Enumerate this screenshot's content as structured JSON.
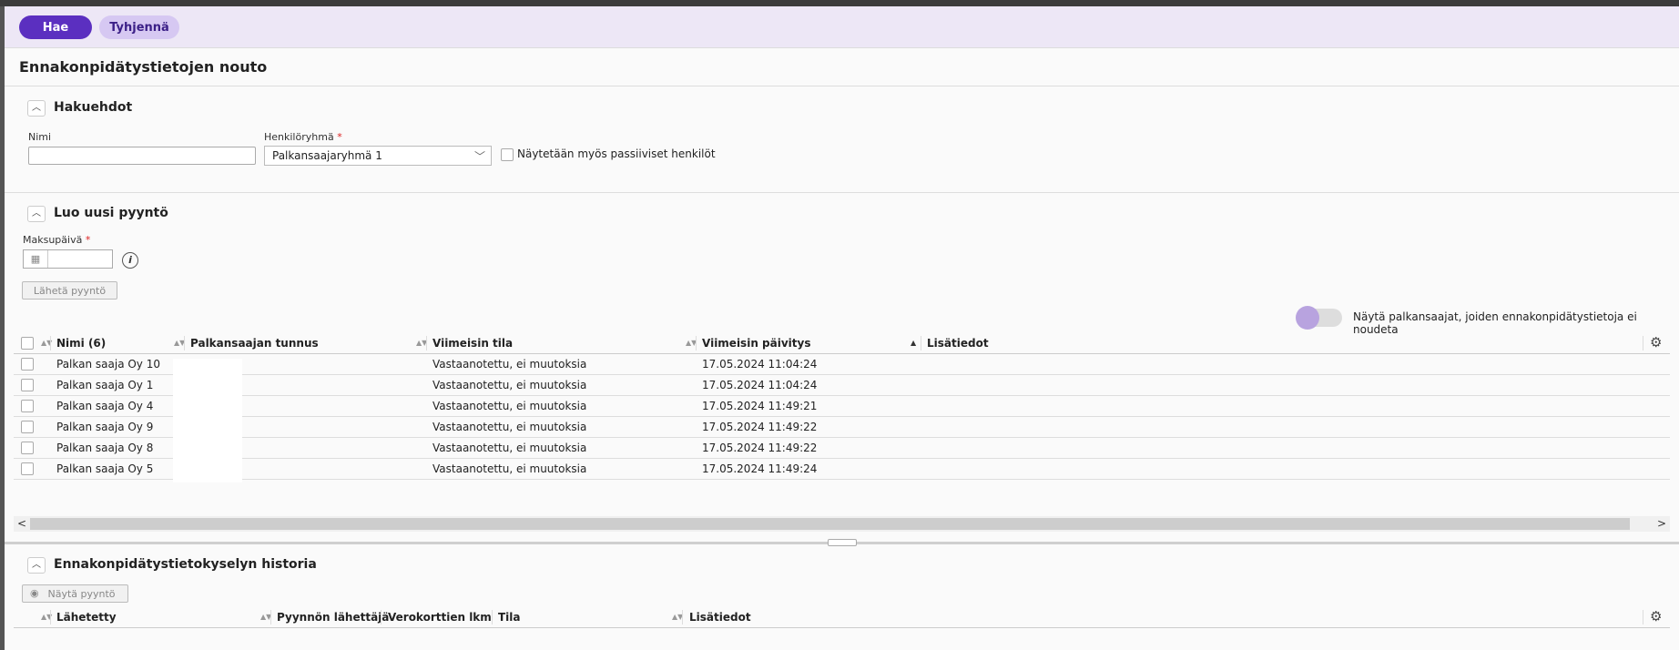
{
  "toolbar": {
    "search_label": "Hae",
    "clear_label": "Tyhjennä"
  },
  "page": {
    "title": "Ennakonpidätystietojen nouto"
  },
  "search_section": {
    "title": "Hakuehdot",
    "name_label": "Nimi",
    "name_value": "",
    "group_label": "Henkilöryhmä",
    "group_required_mark": "*",
    "group_value": "Palkansaajaryhmä 1",
    "passive_checkbox_label": "Näytetään myös passiiviset henkilöt",
    "passive_checked": false
  },
  "new_request_section": {
    "title": "Luo uusi pyyntö",
    "payday_label": "Maksupäivä",
    "payday_required_mark": "*",
    "payday_value": "",
    "send_button_label": "Lähetä pyyntö"
  },
  "filter_toggle": {
    "label": "Näytä palkansaajat, joiden ennakonpidätystietoja ei noudeta",
    "on": false
  },
  "payees_table": {
    "columns": [
      "Nimi (6)",
      "Palkansaajan tunnus",
      "Viimeisin tila",
      "Viimeisin päivitys",
      "Lisätiedot"
    ],
    "rows": [
      {
        "name": "Palkan saaja Oy 10",
        "id": "",
        "status": "Vastaanotettu, ei muutoksia",
        "updated": "17.05.2024 11:04:24",
        "info": ""
      },
      {
        "name": "Palkan saaja Oy 1",
        "id": "",
        "status": "Vastaanotettu, ei muutoksia",
        "updated": "17.05.2024 11:04:24",
        "info": ""
      },
      {
        "name": "Palkan saaja Oy 4",
        "id": "",
        "status": "Vastaanotettu, ei muutoksia",
        "updated": "17.05.2024 11:49:21",
        "info": ""
      },
      {
        "name": "Palkan saaja Oy 9",
        "id": "",
        "status": "Vastaanotettu, ei muutoksia",
        "updated": "17.05.2024 11:49:22",
        "info": ""
      },
      {
        "name": "Palkan saaja Oy 8",
        "id": "",
        "status": "Vastaanotettu, ei muutoksia",
        "updated": "17.05.2024 11:49:22",
        "info": ""
      },
      {
        "name": "Palkan saaja Oy 5",
        "id": "",
        "status": "Vastaanotettu, ei muutoksia",
        "updated": "17.05.2024 11:49:24",
        "info": ""
      }
    ]
  },
  "history_section": {
    "title": "Ennakonpidätystietokyselyn historia",
    "show_request_label": "Näytä pyyntö",
    "columns": [
      "Lähetetty",
      "Pyynnön lähettäjä",
      "Verokorttien lkm",
      "Tila",
      "Lisätiedot"
    ]
  },
  "icons": {
    "collapse": "chevron-up-icon",
    "calendar": "calendar-icon",
    "info": "info-icon",
    "settings": "gear-icon",
    "eye": "eye-icon"
  },
  "colors": {
    "primary": "#5b2fc0",
    "secondary": "#d6c8f2",
    "toolbar_bg": "#ede7f6"
  }
}
